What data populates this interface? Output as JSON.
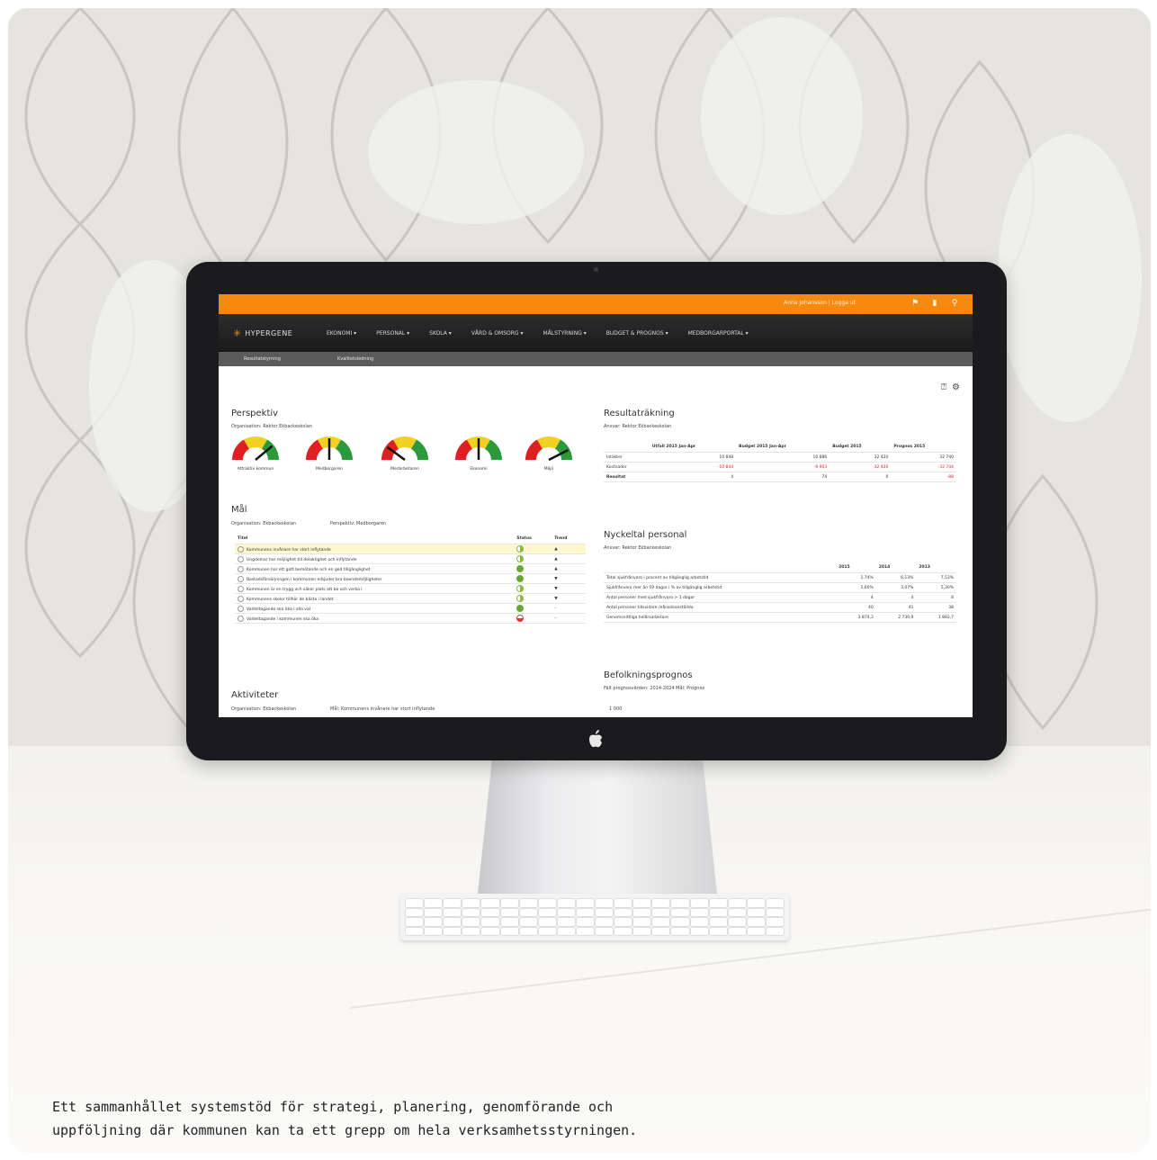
{
  "caption": {
    "line1": "Ett sammanhållet systemstöd för strategi, planering, genomförande och",
    "line2": "uppföljning där kommunen kan ta ett grepp om hela verksamhetsstyrningen."
  },
  "app": {
    "topbar": {
      "user_text": "Anna Johansson | Logga ut",
      "icons": [
        "flag-icon",
        "bookmark-icon",
        "search-icon"
      ],
      "accent_color": "#f7890f"
    },
    "logo": "HYPERGENE",
    "menu": [
      "EKONOMI ▾",
      "PERSONAL ▾",
      "SKOLA ▾",
      "VÅRD & OMSORG ▾",
      "MÅLSTYRNING ▾",
      "BUDGET & PROGNOS ▾",
      "MEDBORGARPORTAL ▾"
    ],
    "subnav": [
      "Resultatstyrning",
      "Kvalitetsledning"
    ]
  },
  "perspektiv": {
    "title": "Perspektiv",
    "org_line": "Organisation: Rektor Ekbackeskolan",
    "gauges": [
      {
        "label": "Attraktiv kommun",
        "level": 0.78
      },
      {
        "label": "Medborgaren",
        "level": 0.5
      },
      {
        "label": "Medarbetaren",
        "level": 0.2
      },
      {
        "label": "Ekonomi",
        "level": 0.5
      },
      {
        "label": "Miljö",
        "level": 0.85
      }
    ]
  },
  "mal": {
    "title": "Mål",
    "org_line": "Organisation: Ekbackeskolan",
    "persp_line": "Perspektiv: Medborgaren",
    "columns": [
      "Titel",
      "Status",
      "Trend"
    ],
    "rows": [
      {
        "title": "Kommunens invånare har stort inflytande",
        "status": "half",
        "trend": "▲",
        "highlight": true
      },
      {
        "title": "Ungdomar har möjlighet till delaktighet och inflytande",
        "status": "half",
        "trend": "▲"
      },
      {
        "title": "Kommunen har ett gott bemötande och en god tillgänglighet",
        "status": "full",
        "trend": "▲"
      },
      {
        "title": "Bostadsförsörjningen i kommunen erbjuder bra boendemöjligheter",
        "status": "full",
        "trend": "▼"
      },
      {
        "title": "Kommunen är en trygg och säker plats att bo och verka i",
        "status": "half",
        "trend": "▼"
      },
      {
        "title": "Kommunens skolor tillhör de bästa i landet",
        "status": "half",
        "trend": "▼"
      },
      {
        "title": "Valdeltagande ska öka i alla val",
        "status": "full",
        "trend": "–"
      },
      {
        "title": "Valdeltagande i kommunen ska öka",
        "status": "red",
        "trend": "–"
      }
    ]
  },
  "aktiviteter": {
    "title": "Aktiviteter",
    "org_line": "Organisation: Ekbackeskolan",
    "mal_line": "Mål: Kommunens invånare har stort inflytande"
  },
  "resultat": {
    "title": "Resultaträkning",
    "ansvar_line": "Ansvar: Rektor Ekbackeskolan",
    "columns": [
      "",
      "Utfall 2015 Jan-Apr",
      "Budget 2015 Jan-Apr",
      "Budget 2015",
      "Prognos 2015"
    ],
    "rows": [
      {
        "label": "Intäkter",
        "values": [
          "10 848",
          "10 886",
          "32 420",
          "32 740"
        ],
        "red": false
      },
      {
        "label": "Kostnader",
        "values": [
          "-10 844",
          "-9 903",
          "-32 420",
          "-32 744"
        ],
        "red": true
      },
      {
        "label": "Resultat",
        "values": [
          "4",
          "74",
          "0",
          "-88"
        ],
        "red_last": true
      }
    ]
  },
  "nyckeltal": {
    "title": "Nyckeltal personal",
    "ansvar_line": "Ansvar: Rektor Ekbackeskolan",
    "columns": [
      "",
      "2015",
      "2014",
      "2013"
    ],
    "rows": [
      {
        "label": "Total sjukfrånvaro i procent av tillgänglig arbetstid",
        "values": [
          "1,74%",
          "6,13%",
          "7,53%"
        ]
      },
      {
        "label": "Sjukfrånvaro mer än 59 dagar i % av tillgänglig arbetstid",
        "values": [
          "1,60%",
          "3,07%",
          "5,30%"
        ]
      },
      {
        "label": "Antal personer med sjukfrånvaro > 1 dagar",
        "values": [
          "4",
          "4",
          "8"
        ]
      },
      {
        "label": "Antal personer tillsvidare månadsanställda",
        "values": [
          "40",
          "41",
          "38"
        ]
      },
      {
        "label": "Genomsnittliga helårsarbetare",
        "values": [
          "3 874,3",
          "2 730,9",
          "1 882,7"
        ]
      }
    ]
  },
  "befolkning": {
    "title": "Befolkningsprognos",
    "line": "Fält prognosvärden: 2014-2024   Mål: Prognos",
    "axis_label": "1 000"
  }
}
